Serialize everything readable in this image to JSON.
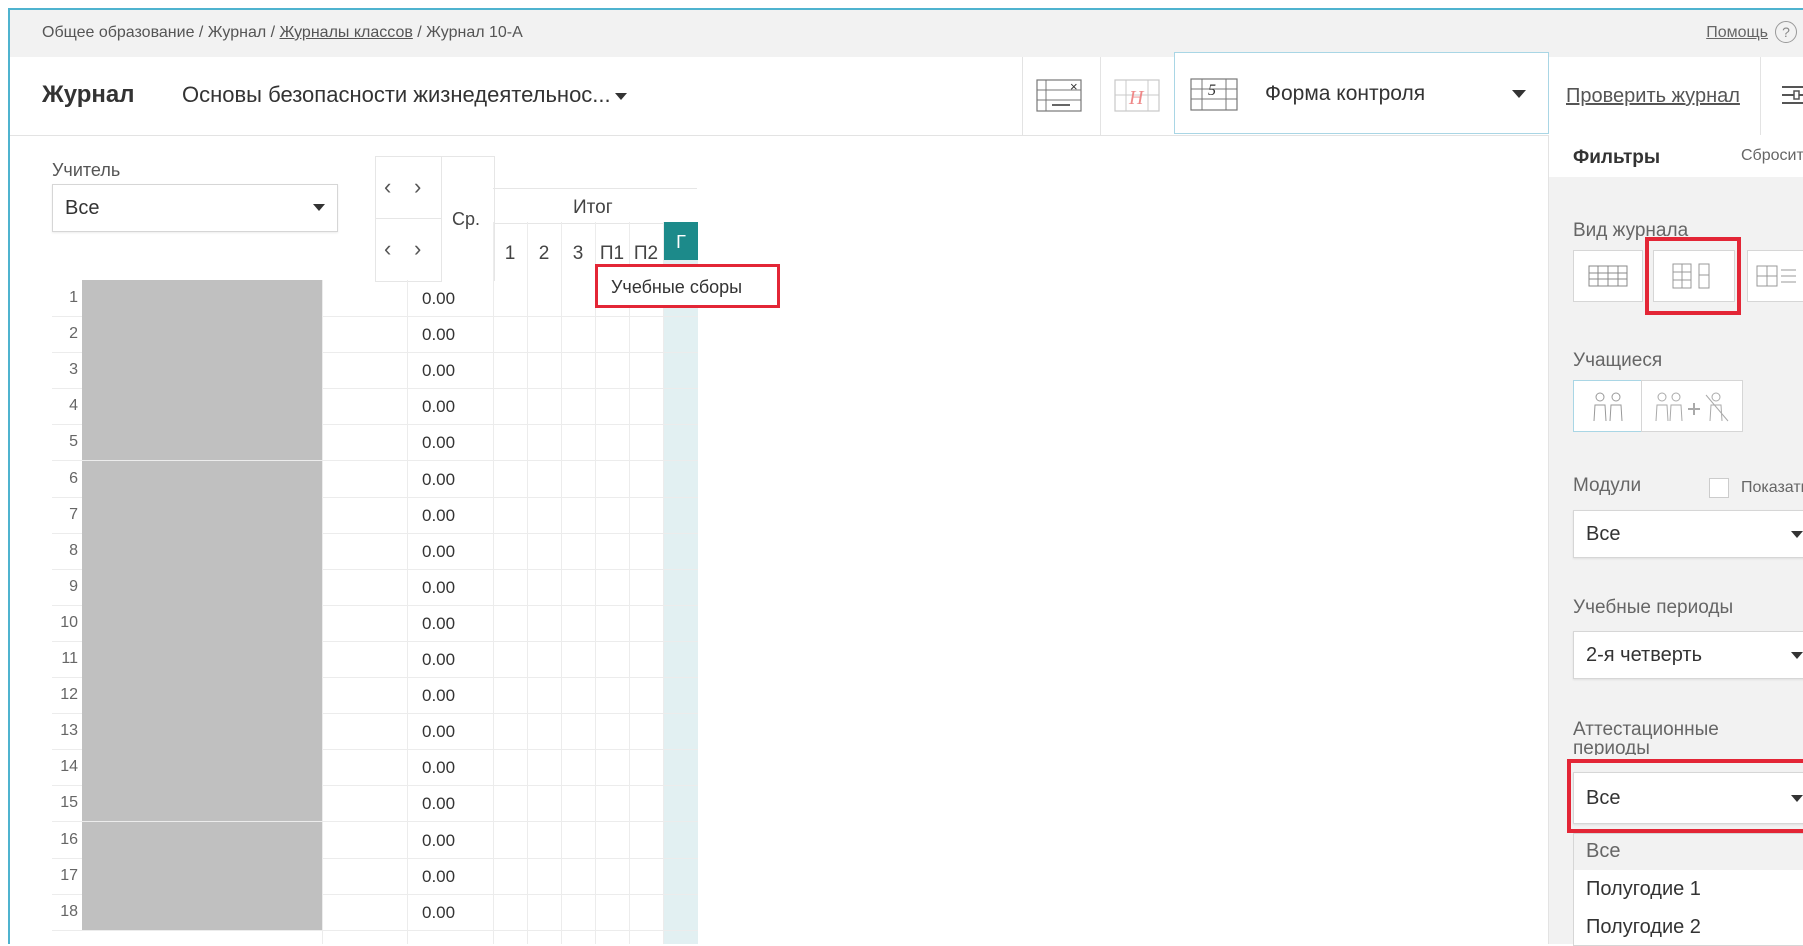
{
  "breadcrumb": {
    "part1": "Общее образование / Журнал / ",
    "link": "Журналы классов",
    "part2": " / Журнал 10-А"
  },
  "help": {
    "label": "Помощь",
    "icon": "?"
  },
  "header": {
    "title": "Журнал",
    "subject": "Основы безопасности жизнедеятельнос...",
    "control_form": "Форма контроля",
    "check_link": "Проверить журнал"
  },
  "teacher": {
    "label": "Учитель",
    "value": "Все"
  },
  "grid": {
    "avg_header": "Ср.",
    "total_header": "Итог",
    "columns": [
      "1",
      "2",
      "3",
      "П1",
      "П2",
      "Г"
    ],
    "tooltip": "Учебные сборы",
    "rows": [
      {
        "n": "1",
        "avg": "0.00"
      },
      {
        "n": "2",
        "avg": "0.00"
      },
      {
        "n": "3",
        "avg": "0.00"
      },
      {
        "n": "4",
        "avg": "0.00"
      },
      {
        "n": "5",
        "avg": "0.00"
      },
      {
        "n": "6",
        "avg": "0.00"
      },
      {
        "n": "7",
        "avg": "0.00"
      },
      {
        "n": "8",
        "avg": "0.00"
      },
      {
        "n": "9",
        "avg": "0.00"
      },
      {
        "n": "10",
        "avg": "0.00"
      },
      {
        "n": "11",
        "avg": "0.00"
      },
      {
        "n": "12",
        "avg": "0.00"
      },
      {
        "n": "13",
        "avg": "0.00"
      },
      {
        "n": "14",
        "avg": "0.00"
      },
      {
        "n": "15",
        "avg": "0.00"
      },
      {
        "n": "16",
        "avg": "0.00"
      },
      {
        "n": "17",
        "avg": "0.00"
      },
      {
        "n": "18",
        "avg": "0.00"
      }
    ]
  },
  "filters": {
    "title": "Фильтры",
    "reset": "Сбросить",
    "journal_view_label": "Вид журнала",
    "students_label": "Учащиеся",
    "modules_label": "Модули",
    "modules_show": "Показать",
    "modules_value": "Все",
    "periods_label": "Учебные периоды",
    "periods_value": "2-я четверть",
    "attestation_label": "Аттестационные периоды",
    "attestation_value": "Все",
    "attestation_options": [
      "Все",
      "Полугодие 1",
      "Полугодие 2"
    ]
  },
  "colors": {
    "accent": "#1c8a8a",
    "highlight": "#e32636",
    "frame": "#4fb3cf"
  }
}
